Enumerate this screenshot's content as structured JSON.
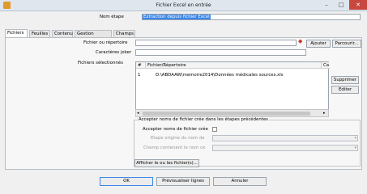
{
  "window": {
    "title": "Fichier Excel en entrée"
  },
  "header": {
    "step_name_label": "Nom étape",
    "step_name_value": "Extraction depuis fichier Excel"
  },
  "tabs": [
    {
      "label": "Fichiers"
    },
    {
      "label": "Feuilles"
    },
    {
      "label": "Contenu"
    },
    {
      "label": "Gestion erreurs"
    },
    {
      "label": "Champs"
    }
  ],
  "files_tab": {
    "file_dir_label": "Fichier ou répertoire",
    "wildcard_label": "Caractères joker",
    "selected_files_label": "Fichiers sélectionnés",
    "add_button": "Ajouter",
    "browse_button": "Parcourir...",
    "table": {
      "columns": [
        "#",
        "Fichier/Répertoire",
        "Ca"
      ],
      "rows": [
        {
          "num": "1",
          "path": "D:\\ABDAAW\\memoire2014\\Données médicales sources.xls"
        }
      ]
    },
    "delete_button": "Supprimer",
    "edit_button": "Editer",
    "group": {
      "title": "Accepter noms de fichier crée dans les étapes précédentes",
      "accept_label": "Accepter noms de fichier crée",
      "origin_step_label": "Etape origine du nom de",
      "field_name_label": "Champ contenant le nom ce"
    },
    "show_files_button": "Afficher le ou les fichier(s)..."
  },
  "footer": {
    "ok_button": "OK",
    "preview_button": "Prévisualiser lignes",
    "cancel_button": "Annuler"
  }
}
